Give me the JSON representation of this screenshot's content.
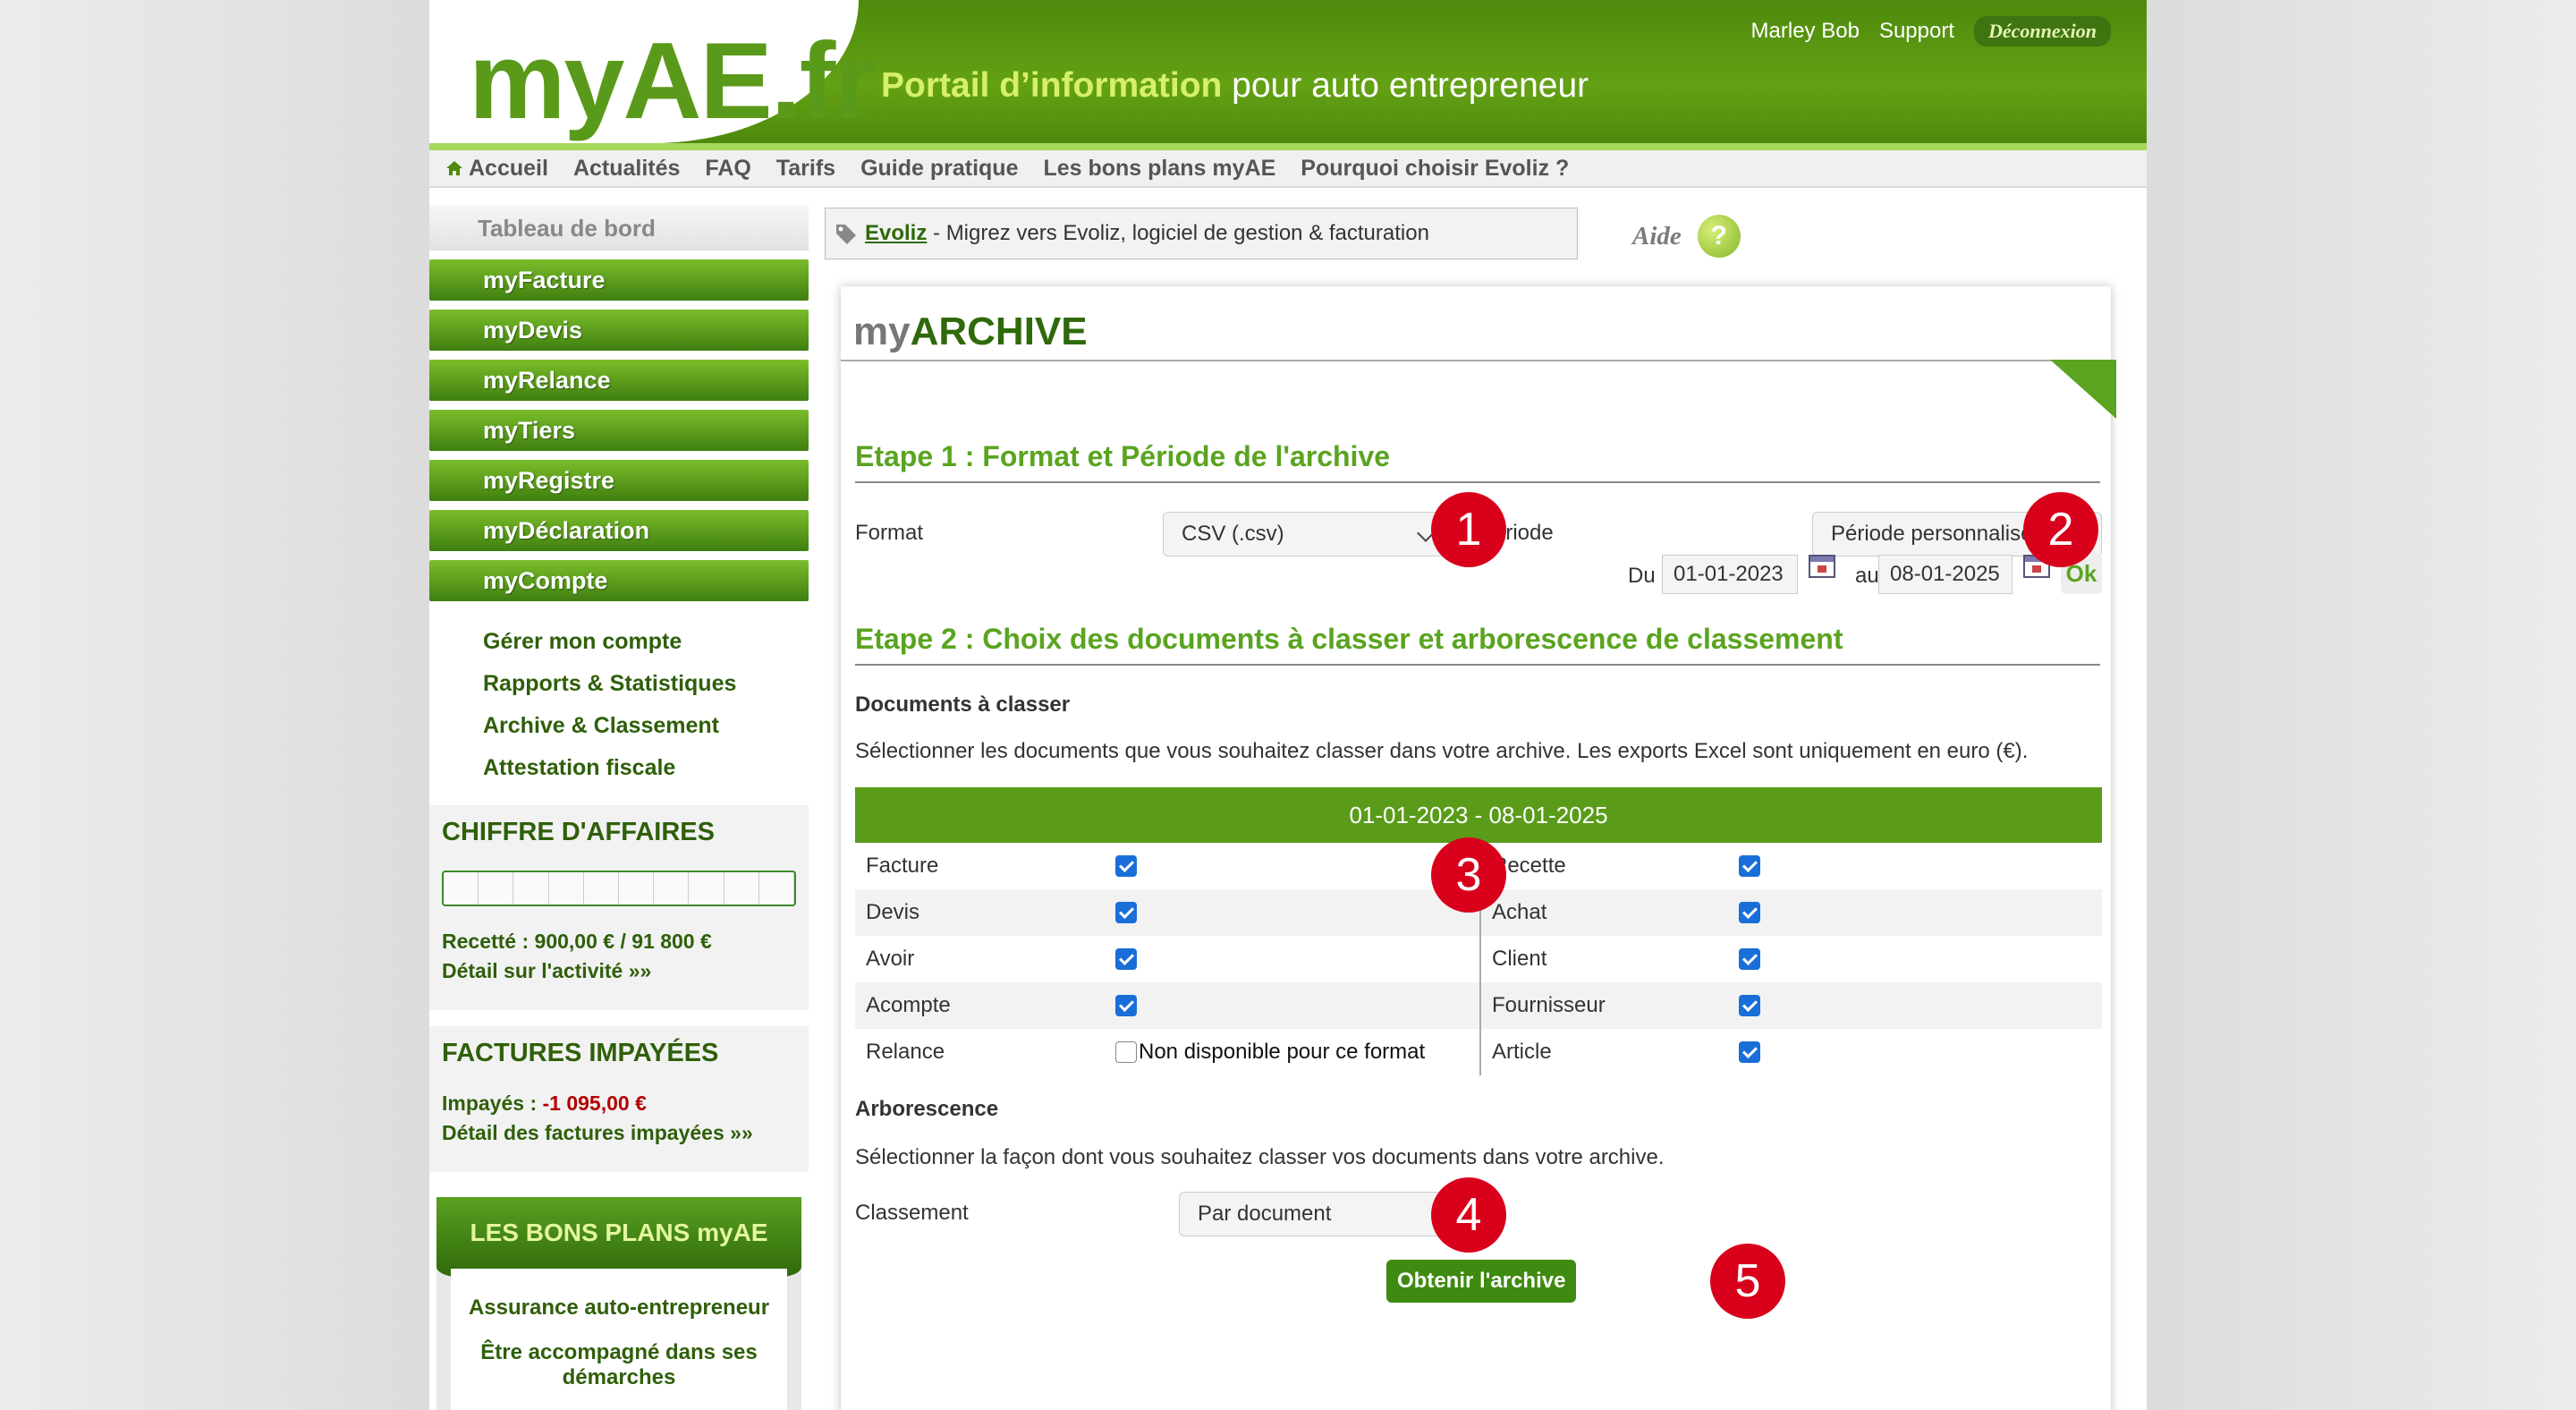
{
  "header": {
    "logo": "myAE.fr",
    "tagline_highlight": "Portail d’information",
    "tagline_rest": " pour auto entrepreneur",
    "user_name": "Marley Bob",
    "support": "Support",
    "logout": "Déconnexion"
  },
  "nav": [
    "Accueil",
    "Actualités",
    "FAQ",
    "Tarifs",
    "Guide pratique",
    "Les bons plans myAE",
    "Pourquoi choisir Evoliz ?"
  ],
  "sidebar": {
    "dashboard": "Tableau de bord",
    "menu": [
      "myFacture",
      "myDevis",
      "myRelance",
      "myTiers",
      "myRegistre",
      "myDéclaration",
      "myCompte"
    ],
    "submenu": [
      "Gérer mon compte",
      "Rapports & Statistiques",
      "Archive & Classement",
      "Attestation fiscale"
    ],
    "ca": {
      "title": "CHIFFRE D'AFFAIRES",
      "progress_fraction": 0.01,
      "recette": "Recetté : 900,00 € / 91 800 €",
      "detail": "Détail sur l'activité »»"
    },
    "impayees": {
      "title": "FACTURES IMPAYÉES",
      "label": "Impayés : ",
      "amount": "-1 095,00 €",
      "detail": "Détail des factures impayées »»"
    },
    "bonsplans": {
      "title": "LES BONS PLANS myAE",
      "items": [
        "Assurance auto-entrepreneur",
        "Être accompagné dans ses démarches"
      ]
    }
  },
  "promo": {
    "link": "Evoliz",
    "text": " - Migrez vers Evoliz, logiciel de gestion & facturation"
  },
  "aide": "Aide",
  "main": {
    "title_prefix": "my",
    "title_main": "ARCHIVE",
    "step1": "Etape 1 : Format et Période de l'archive",
    "format_label": "Format",
    "format_value": "CSV (.csv)",
    "required": "*",
    "periode_label": "Période",
    "periode_value": "Période personnalisée",
    "du_label": "Du",
    "du_value": "01-01-2023",
    "au_label": "au",
    "au_value": "08-01-2025",
    "ok": "Ok",
    "step2": "Etape 2 : Choix des documents à classer et arborescence de classement",
    "docs_heading": "Documents à classer",
    "docs_desc": "Sélectionner les documents que vous souhaitez classer dans votre archive. Les exports Excel sont uniquement en euro (€).",
    "table_header": "01-01-2023 - 08-01-2025",
    "rows": [
      {
        "left": "Facture",
        "left_checked": true,
        "right": "Recette",
        "right_checked": true
      },
      {
        "left": "Devis",
        "left_checked": true,
        "right": "Achat",
        "right_checked": true
      },
      {
        "left": "Avoir",
        "left_checked": true,
        "right": "Client",
        "right_checked": true
      },
      {
        "left": "Acompte",
        "left_checked": true,
        "right": "Fournisseur",
        "right_checked": true
      },
      {
        "left": "Relance",
        "left_checked": false,
        "left_note": "Non disponible pour ce format",
        "right": "Article",
        "right_checked": true
      }
    ],
    "arbo_heading": "Arborescence",
    "arbo_desc": "Sélectionner la façon dont vous souhaitez classer vos documents dans votre archive.",
    "classement_label": "Classement",
    "classement_value": "Par document",
    "submit": "Obtenir l'archive"
  },
  "badges": [
    "1",
    "2",
    "3",
    "4",
    "5"
  ],
  "colors": {
    "brand_green": "#5aa420",
    "badge_red": "#d9001b",
    "checkbox_blue": "#1a6ed8"
  }
}
